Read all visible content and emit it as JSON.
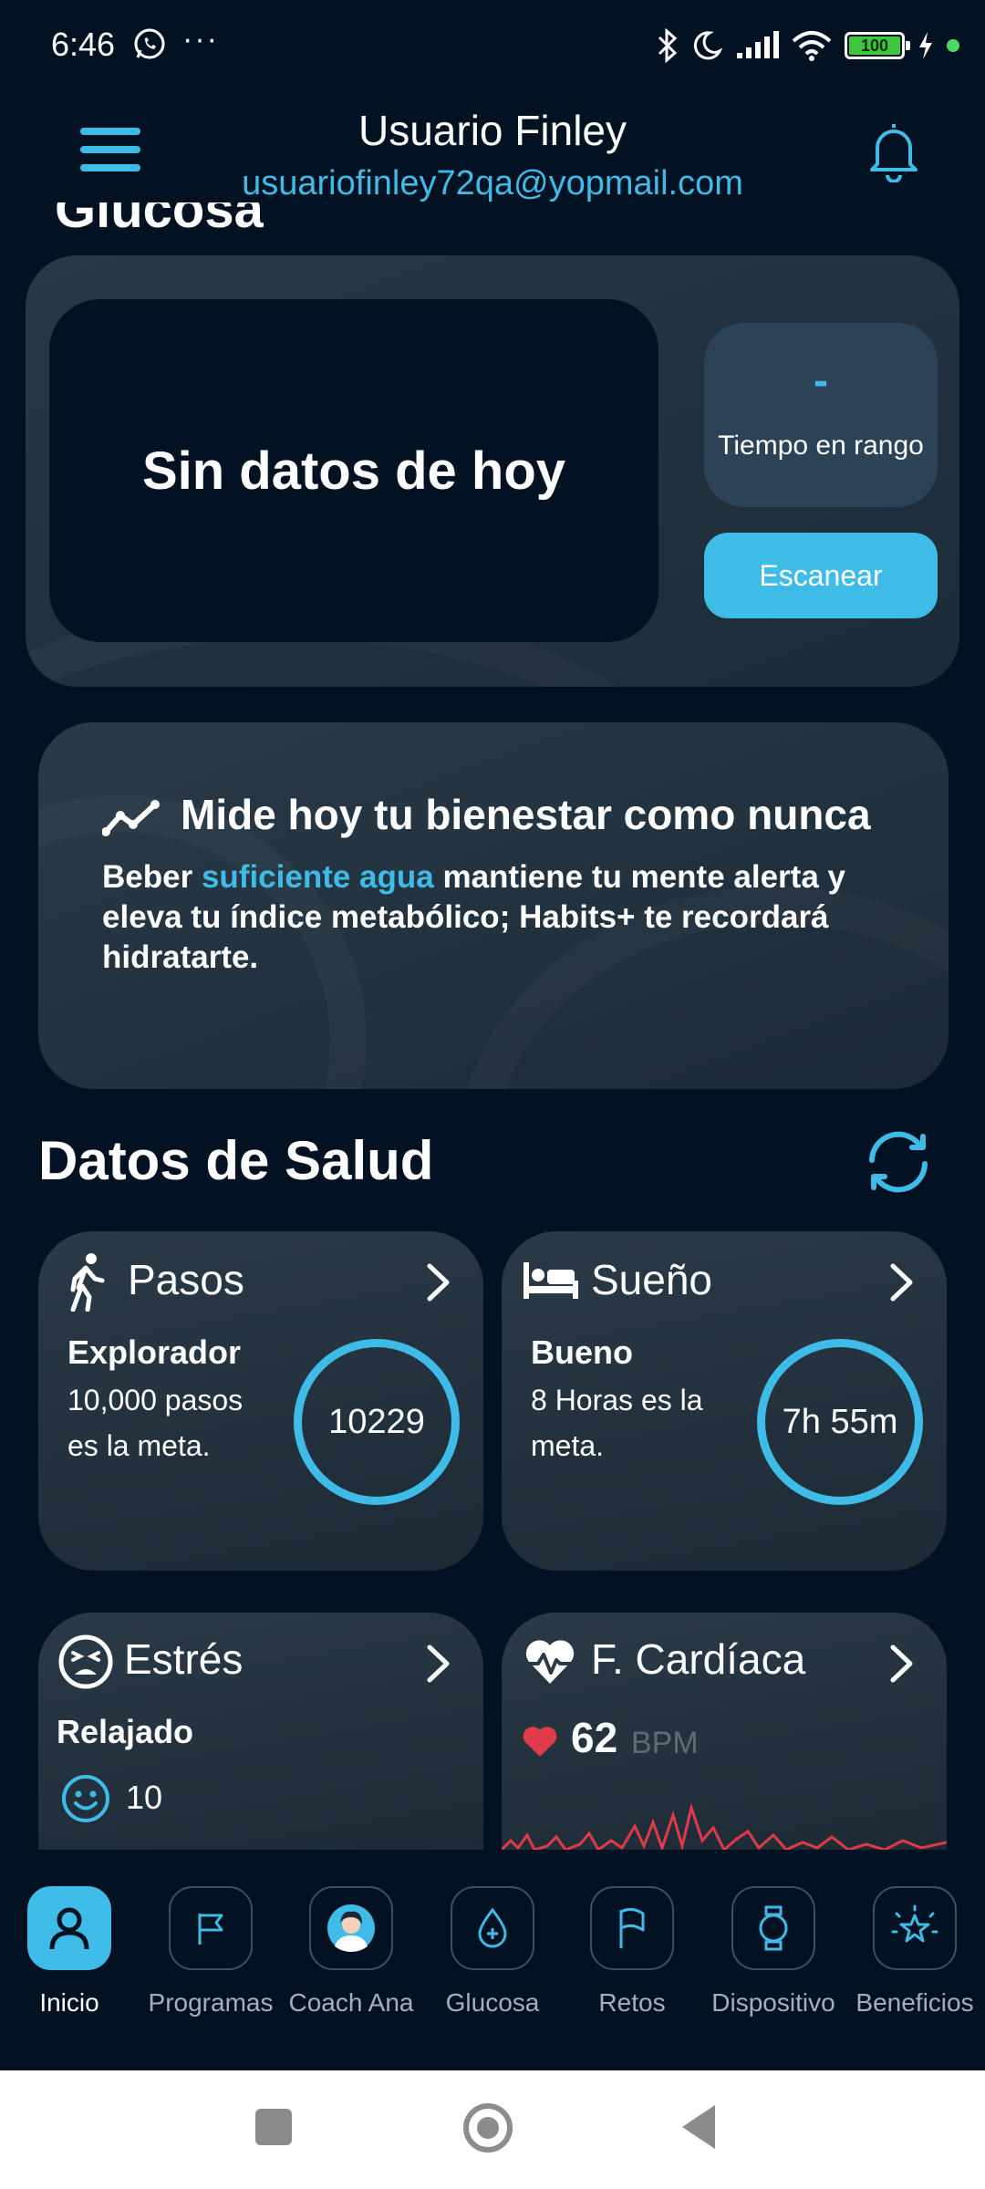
{
  "status_bar": {
    "time": "6:46",
    "dots": "···",
    "battery": "100"
  },
  "header": {
    "user_name": "Usuario Finley",
    "email": "usuariofinley72qa@yopmail.com"
  },
  "glucose_card": {
    "clipped_title": "Glucosa",
    "no_data": "Sin datos de hoy",
    "time_in_range_value": "-",
    "time_in_range_label": "Tiempo en rango",
    "scan_button": "Escanear"
  },
  "wellness": {
    "title": "Mide hoy tu bienestar como nunca",
    "body_before": "Beber ",
    "body_highlight": "suficiente agua",
    "body_after": " mantiene tu mente alerta y eleva tu índice metabólico; Habits+ te recordará hidratarte."
  },
  "health": {
    "section_title": "Datos de Salud",
    "pasos": {
      "title": "Pasos",
      "level": "Explorador",
      "goal": "10,000 pasos es la meta.",
      "value": "10229"
    },
    "sueno": {
      "title": "Sueño",
      "level": "Bueno",
      "goal": "8 Horas es la meta.",
      "value": "7h 55m"
    },
    "estres": {
      "title": "Estrés",
      "level": "Relajado",
      "value": "10"
    },
    "cardio": {
      "title": "F. Cardíaca",
      "value": "62",
      "unit": "BPM"
    }
  },
  "nav": {
    "items": [
      {
        "label": "Inicio",
        "icon": "user-icon",
        "active": true
      },
      {
        "label": "Programas",
        "icon": "flag-icon",
        "active": false
      },
      {
        "label": "Coach Ana",
        "icon": "coach-avatar-icon",
        "active": false
      },
      {
        "label": "Glucosa",
        "icon": "drop-icon",
        "active": false
      },
      {
        "label": "Retos",
        "icon": "flag-icon",
        "active": false
      },
      {
        "label": "Dispositivo",
        "icon": "watch-icon",
        "active": false
      },
      {
        "label": "Beneficios",
        "icon": "star-badge-icon",
        "active": false
      }
    ]
  },
  "colors": {
    "background": "#021222",
    "accent": "#3fbbe8",
    "card": "#283846",
    "heart": "#e03a48"
  }
}
